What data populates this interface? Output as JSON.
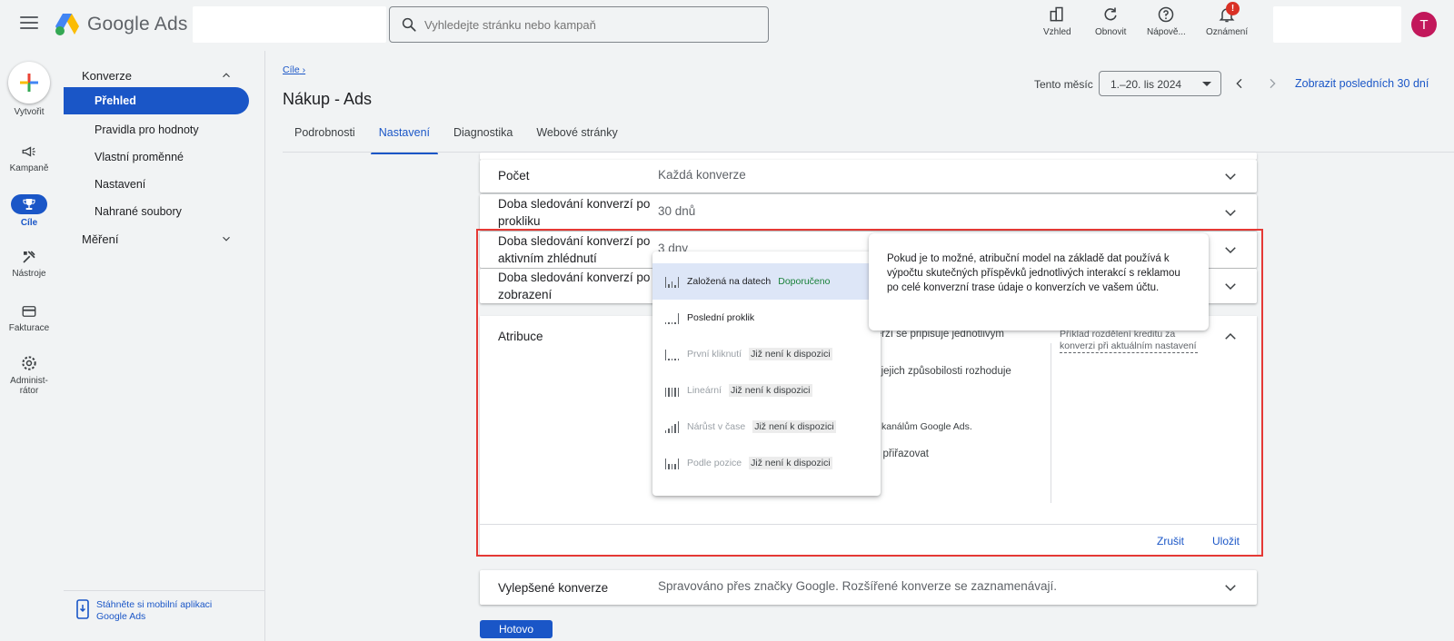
{
  "header": {
    "app_name": "Google Ads",
    "search_placeholder": "Vyhledejte stránku nebo kampaň",
    "actions": [
      {
        "label": "Vzhled",
        "icon": "appearance-icon"
      },
      {
        "label": "Obnovit",
        "icon": "refresh-icon"
      },
      {
        "label": "Nápově...",
        "icon": "help-icon"
      },
      {
        "label": "Oznámení",
        "icon": "bell-icon",
        "badge": "!"
      }
    ],
    "avatar_letter": "T"
  },
  "rail": {
    "create": "Vytvořit",
    "items": [
      "Kampaně",
      "Cíle",
      "Nástroje",
      "Fakturace",
      "Administ-rátor"
    ],
    "active": "Cíle"
  },
  "subnav": {
    "section_conversions": "Konverze",
    "items": [
      "Přehled",
      "Pravidla pro hodnoty",
      "Vlastní proměnné",
      "Nastavení",
      "Nahrané soubory"
    ],
    "active": "Přehled",
    "section_measurement": "Měření",
    "app_link": "Stáhněte si mobilní aplikaci Google Ads"
  },
  "page": {
    "breadcrumb": "Cíle",
    "title": "Nákup - Ads",
    "tabs": [
      "Podrobnosti",
      "Nastavení",
      "Diagnostika",
      "Webové stránky"
    ],
    "active_tab": "Nastavení"
  },
  "date": {
    "label": "Tento měsíc",
    "range": "1.–20. lis 2024",
    "last30": "Zobrazit posledních 30 dní"
  },
  "settings": {
    "count_label": "Počet",
    "count_value": "Každá konverze",
    "click_label": "Doba sledování konverzí po prokliku",
    "click_value": "30 dnů",
    "engaged_label": "Doba sledování konverzí po aktivním zhlédnutí",
    "engaged_value": "3 dny",
    "view_label": "Doba sledování konverzí po zobrazení",
    "attribution_label": "Atribuce",
    "attribution_frag1": "verzí se připisuje jednotlivým",
    "attribution_frag2": "o jejich způsobilosti rozhoduje",
    "attribution_frag3": "kanálům Google Ads.",
    "attribution_frag4": "lit přiřazovat",
    "example_link": "Příklad rozdělení kreditu za konverzi při aktuálním nastavení",
    "cancel": "Zrušit",
    "save": "Uložit",
    "enhanced_label": "Vylepšené konverze",
    "enhanced_value": "Spravováno přes značky Google. Rozšířené konverze se zaznamenávají.",
    "done": "Hotovo"
  },
  "dropdown": {
    "items": [
      {
        "name": "Založená na datech",
        "tag": "Doporučeno",
        "state": "selected"
      },
      {
        "name": "Poslední proklik",
        "tag": "",
        "state": "enabled"
      },
      {
        "name": "První kliknutí",
        "tag": "Již není k dispozici",
        "state": "disabled"
      },
      {
        "name": "Lineární",
        "tag": "Již není k dispozici",
        "state": "disabled"
      },
      {
        "name": "Nárůst v čase",
        "tag": "Již není k dispozici",
        "state": "disabled"
      },
      {
        "name": "Podle pozice",
        "tag": "Již není k dispozici",
        "state": "disabled"
      }
    ]
  },
  "tooltip": {
    "text": "Pokud je to možné, atribuční model na základě dat používá k výpočtu skutečných příspěvků jednotlivých interakcí s reklamou po celé konverzní trase údaje o konverzích ve vašem účtu."
  },
  "colors": {
    "accent": "#1a56c7",
    "highlight": "#e53935",
    "recommended": "#188038",
    "badge": "#d93025"
  }
}
